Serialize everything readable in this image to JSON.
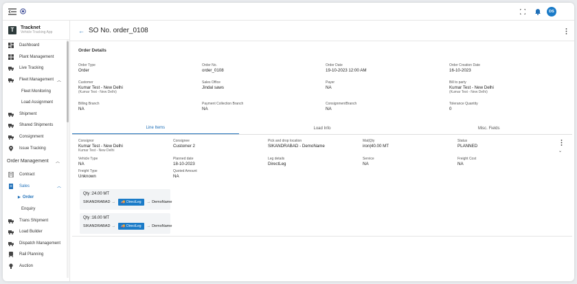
{
  "topbar": {
    "avatar_initials": "DS"
  },
  "brand": {
    "name": "Tracknet",
    "subtitle": "Vehicle Tracking App"
  },
  "sidebar": {
    "items": [
      {
        "label": "Dashboard",
        "icon": "dashboard-icon"
      },
      {
        "label": "Plant Management",
        "icon": "plant-icon"
      },
      {
        "label": "Live Tracking",
        "icon": "truck-icon"
      },
      {
        "label": "Fleet Management",
        "icon": "fleet-icon"
      },
      {
        "label": "Fleet Monitoring"
      },
      {
        "label": "Load Assignment"
      },
      {
        "label": "Shipment",
        "icon": "shipment-icon"
      },
      {
        "label": "Shared Shipments",
        "icon": "shared-icon"
      },
      {
        "label": "Consignment",
        "icon": "consignment-icon"
      },
      {
        "label": "Issue Tracking",
        "icon": "pin-icon"
      },
      {
        "label": "Order Management"
      },
      {
        "label": "Contract",
        "icon": "contract-icon"
      },
      {
        "label": "Sales",
        "icon": "sales-icon"
      },
      {
        "label": "Order"
      },
      {
        "label": "Enquiry"
      },
      {
        "label": "Trans Shipment",
        "icon": "trans-icon"
      },
      {
        "label": "Load Builder",
        "icon": "loadbuilder-icon"
      },
      {
        "label": "Dispatch Management",
        "icon": "dispatch-icon"
      },
      {
        "label": "Rail Planning",
        "icon": "rail-icon"
      },
      {
        "label": "Auction",
        "icon": "auction-icon"
      }
    ]
  },
  "header": {
    "title": "SO No. order_0108"
  },
  "order_details": {
    "heading": "Order Details",
    "row1": [
      {
        "label": "Order Type",
        "value": "Order"
      },
      {
        "label": "Order No.",
        "value": "order_0108"
      },
      {
        "label": "Order Date",
        "value": "19-10-2023 12:00 AM"
      },
      {
        "label": "Order Creation Date",
        "value": "16-10-2023"
      }
    ],
    "row2": [
      {
        "label": "Customer",
        "value": "Kumar Test - New Delhi",
        "sub": "(Kumar Test - New Delhi)"
      },
      {
        "label": "Sales Office",
        "value": "Jindal saws",
        "sub": ""
      },
      {
        "label": "Payer",
        "value": "NA",
        "sub": ""
      },
      {
        "label": "Bill to party",
        "value": "Kumar Test - New Delhi",
        "sub": "(Kumar Test - New Delhi)"
      }
    ],
    "row3": [
      {
        "label": "Billing Branch",
        "value": "NA"
      },
      {
        "label": "Payment Collection Branch",
        "value": "NA"
      },
      {
        "label": "ConsignmentBranch",
        "value": "NA"
      },
      {
        "label": "Tolerance Quantity",
        "value": "0"
      }
    ]
  },
  "tabs": [
    "Line Items",
    "Load Info",
    "Misc. Fields"
  ],
  "line_item": {
    "row1": [
      {
        "label": "Consignor",
        "value": "Kumar Test - New Delhi",
        "sub": "Kumar Test - New Delhi"
      },
      {
        "label": "Consignee",
        "value": "Customer 2",
        "sub": ""
      },
      {
        "label": "Pick and drop location",
        "value": "SIKANDRABAD - DemoName",
        "sub": ""
      },
      {
        "label": "Mat|Qty",
        "value": "iron|40.00 MT",
        "sub": ""
      },
      {
        "label": "Status",
        "value": "PLANNED",
        "sub": ""
      }
    ],
    "row2": [
      {
        "label": "Vehicle Type",
        "value": "NA"
      },
      {
        "label": "Planned date",
        "value": "18-10-2023"
      },
      {
        "label": "Leg details",
        "value": "DirectLeg"
      },
      {
        "label": "Service",
        "value": "NA"
      },
      {
        "label": "Freight Cost",
        "value": "NA"
      }
    ],
    "row3": [
      {
        "label": "Freight Type",
        "value": "Unknown"
      },
      {
        "label": "Quoted Amount",
        "value": "NA"
      }
    ]
  },
  "legs": [
    {
      "qty": "Qty :24.00 MT",
      "from": "SIKANDRABAD",
      "leg": "DirectLeg",
      "to": "DemoName"
    },
    {
      "qty": "Qty :16.00 MT",
      "from": "SIKANDRABAD",
      "leg": "DirectLeg",
      "to": "DemoName"
    }
  ],
  "colors": {
    "accent": "#1e6fb8",
    "pill": "#1a7bc8",
    "brand_logo": "#2d3a3a"
  }
}
